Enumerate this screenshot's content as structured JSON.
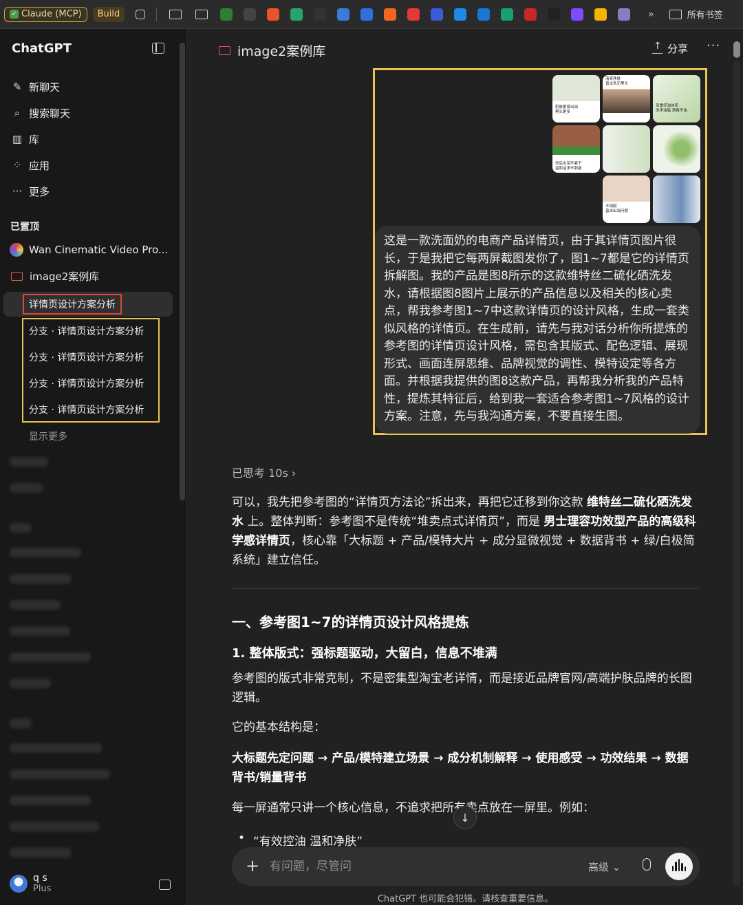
{
  "bookmarks": {
    "claude_label": "Claude (MCP)",
    "build_label": "Build",
    "more_label": "»",
    "all_label": "所有书签",
    "site_colors": [
      "#2e7d32",
      "#444444",
      "#e8552a",
      "#2aa36b",
      "#333333",
      "#3a7bd5",
      "#2f6fe0",
      "#f26522",
      "#e53935",
      "#3b5bdb",
      "#1e88e5",
      "#1976d2",
      "#1aa06d",
      "#c62828",
      "#222222",
      "#7c4dff",
      "#f5b400",
      "#8e7cc3"
    ]
  },
  "sidebar": {
    "brand": "ChatGPT",
    "nav": [
      {
        "label": "新聊天",
        "icon": "edit-icon"
      },
      {
        "label": "搜索聊天",
        "icon": "search-icon"
      },
      {
        "label": "库",
        "icon": "library-icon"
      },
      {
        "label": "应用",
        "icon": "apps-icon"
      },
      {
        "label": "更多",
        "icon": "more-icon"
      }
    ],
    "pinned_title": "已置顶",
    "pinned": [
      {
        "label": "Wan Cinematic Video Pro..."
      },
      {
        "label": "image2案例库"
      }
    ],
    "active_chat": "详情页设计方案分析",
    "branches": [
      "分支 · 详情页设计方案分析",
      "分支 · 详情页设计方案分析",
      "分支 · 详情页设计方案分析",
      "分支 · 详情页设计方案分析"
    ],
    "show_more": "显示更多",
    "user": {
      "name": "q s",
      "plan": "Plus"
    }
  },
  "main": {
    "title": "image2案例库",
    "share_label": "分享",
    "more_label": "···",
    "user_message": "这是一款洗面奶的电商产品详情页，由于其详情页图片很长，于是我把它每两屏截图发你了，图1~7都是它的详情页拆解图。我的产品是图8所示的这款维特丝二硫化硒洗发水，请根据图8图片上展示的产品信息以及相关的核心卖点，帮我参考图1~7中这款详情页的设计风格，生成一套类似风格的详情页。在生成前，请先与我对话分析你所提炼的参考图的详情页设计风格，需包含其版式、配色逻辑、展现形式、画面连屏思维、品牌视觉的调性、模特设定等各方面。并根据我提供的图8这款产品，再帮我分析我的产品特性，提炼其特征后，给到我一套适合参考图1~7风格的设计方案。注意，先与我沟通方案，不要直接生图。",
    "thumb_texts": [
      "肌肤更易出油\n黑头更多",
      "清爽净肤\n直击洗无黑头",
      "双重控油体系\n洗净油脂 清爽不油",
      "洗后水润不紧干\n温和洁净不刺激",
      "",
      "",
      "",
      "不油腻\n直击出油问题",
      ""
    ],
    "thought": "已思考 10s ›",
    "intro_pre": "可以，我先把参考图的“详情页方法论”拆出来，再把它迁移到你这款 ",
    "intro_b1": "维特丝二硫化硒洗发水",
    "intro_mid": " 上。整体判断：参考图不是传统“堆卖点式详情页”，而是 ",
    "intro_b2": "男士理容功效型产品的高级科学感详情页",
    "intro_post": "，核心靠「大标题 + 产品/模特大片 + 成分显微视觉 + 数据背书 + 绿/白极简系统」建立信任。",
    "h2": "一、参考图1~7的详情页设计风格提炼",
    "h3": "1. 整体版式：强标题驱动，大留白，信息不堆满",
    "p1": "参考图的版式非常克制，不是密集型淘宝老详情，而是接近品牌官网/高端护肤品牌的长图逻辑。",
    "p2": "它的基本结构是：",
    "flow": "大标题先定问题 → 产品/模特建立场景 → 成分机制解释 → 使用感受 → 功效结果 → 数据背书/销量背书",
    "p3": "每一屏通常只讲一个核心信息，不追求把所有卖点放在一屏里。例如：",
    "bullet": "“有效控油 温和净肤”",
    "composer_placeholder": "有问题，尽管问",
    "model_label": "高级 ⌄",
    "disclaimer": "ChatGPT 也可能会犯错。请核查重要信息。"
  },
  "colors": {
    "accent_yellow": "#e8c252",
    "accent_red": "#e2472f",
    "brand_green": "#6aa84f"
  }
}
